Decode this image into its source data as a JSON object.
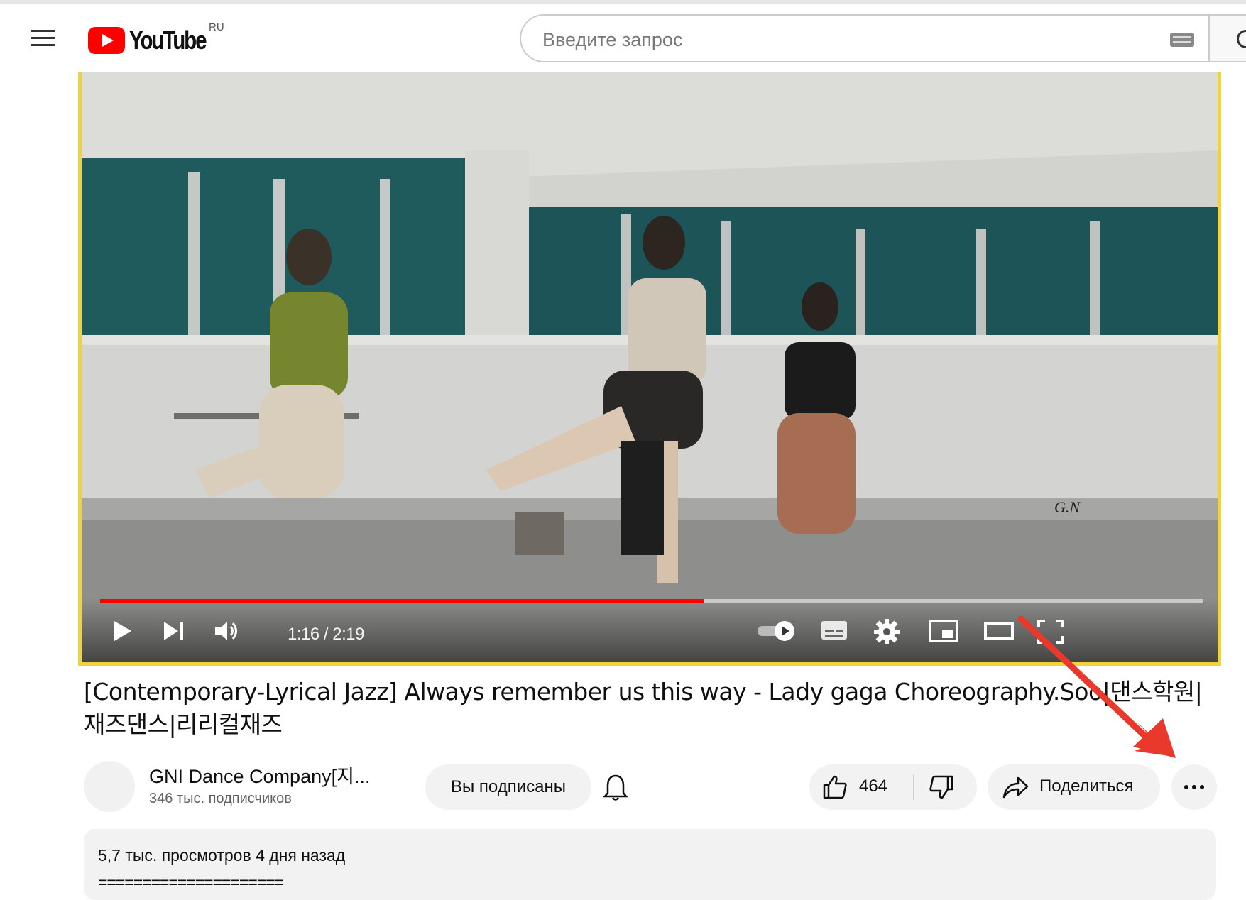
{
  "header": {
    "logo_text": "YouTube",
    "region": "RU",
    "search_placeholder": "Введите запрос"
  },
  "player": {
    "current_time": "1:16",
    "duration": "2:19",
    "time_display": "1:16 / 2:19",
    "progress_fraction": 0.547,
    "watermark": "G.N",
    "colors": {
      "progress": "#ff0000",
      "player_border": "#f2d23c"
    }
  },
  "video": {
    "title": "[Contemporary-Lyrical Jazz] Always remember us this way - Lady gaga Choreography.Soo|댄스학원|재즈댄스|리리컬재즈"
  },
  "channel": {
    "name": "GNI Dance Company[지...",
    "subscribers": "346 тыс. подписчиков"
  },
  "actions": {
    "subscribe_label": "Вы подписаны",
    "like_count": "464",
    "share_label": "Поделиться"
  },
  "description": {
    "meta": "5,7 тыс. просмотров  4 дня назад",
    "first_line": "====================="
  },
  "annotation": {
    "arrow_color": "#e8392c"
  }
}
